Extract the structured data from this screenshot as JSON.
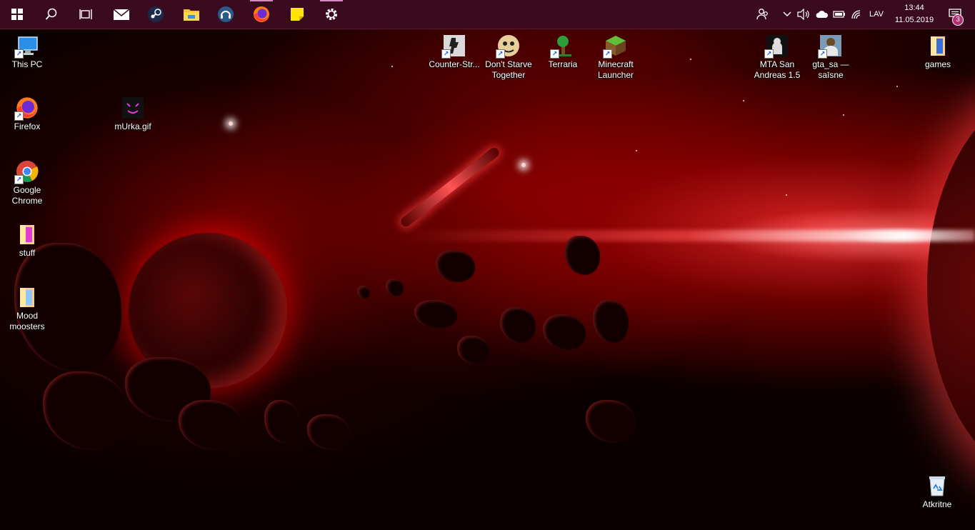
{
  "taskbar": {
    "pinned": [
      {
        "id": "start",
        "icon": "windows-logo-icon"
      },
      {
        "id": "search",
        "icon": "search-icon"
      },
      {
        "id": "task-view",
        "icon": "task-view-icon"
      },
      {
        "id": "mail",
        "icon": "mail-icon"
      },
      {
        "id": "steam",
        "icon": "steam-icon"
      },
      {
        "id": "file-explorer",
        "icon": "folder-icon"
      },
      {
        "id": "teamspeak",
        "icon": "headset-icon"
      },
      {
        "id": "firefox",
        "icon": "firefox-icon",
        "running": true
      },
      {
        "id": "sticky-notes",
        "icon": "sticky-note-icon"
      },
      {
        "id": "settings",
        "icon": "gear-icon",
        "running": true
      }
    ],
    "tray": {
      "language": "LAV",
      "time": "13:44",
      "date": "11.05.2019",
      "notification_count": "3"
    }
  },
  "desktop": {
    "icons": [
      {
        "label": "This PC",
        "icon": "computer-icon"
      },
      {
        "label": "Firefox",
        "icon": "firefox-icon"
      },
      {
        "label": "mUrka.gif",
        "icon": "gif-image-icon"
      },
      {
        "label": "Google Chrome",
        "icon": "chrome-icon"
      },
      {
        "label": "stuff",
        "icon": "folder-icon"
      },
      {
        "label": "Mood moosters",
        "icon": "folder-icon"
      },
      {
        "label": "Counter-Str...",
        "icon": "counter-strike-icon"
      },
      {
        "label": "Don't Starve Together",
        "icon": "dont-starve-icon"
      },
      {
        "label": "Terraria",
        "icon": "terraria-icon"
      },
      {
        "label": "Minecraft Launcher",
        "icon": "minecraft-icon"
      },
      {
        "label": "MTA San Andreas 1.5",
        "icon": "mta-icon"
      },
      {
        "label": "gta_sa — saīsne",
        "icon": "gta-sa-icon"
      },
      {
        "label": "games",
        "icon": "folder-icon"
      },
      {
        "label": "Atkritne",
        "icon": "recycle-bin-icon"
      }
    ]
  },
  "colors": {
    "taskbar_bg": "#3a0a1f",
    "running_indicator": "#d48bc0",
    "badge": "#b03070"
  }
}
